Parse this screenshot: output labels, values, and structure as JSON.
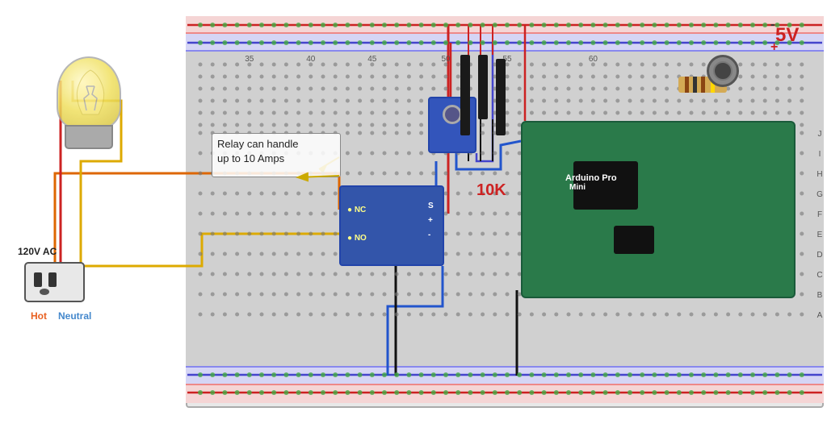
{
  "labels": {
    "voltage": "5V",
    "voltage_minus": "-",
    "voltage_plus": "+",
    "ac_voltage": "120V AC",
    "hot": "Hot",
    "neutral": "Neutral",
    "potentiometer_value": "10K",
    "annotation_line1": "Relay can handle",
    "annotation_line2": "up to 10 Amps",
    "relay_nc": "● NC",
    "relay_no": "● NO",
    "relay_s": "S",
    "relay_plus": "+",
    "relay_minus": "-",
    "arduino_label": "Arduino Pro",
    "arduino_sub": "Mini"
  },
  "colors": {
    "red_wire": "#cc2222",
    "black_wire": "#111111",
    "blue_wire": "#2255cc",
    "yellow_wire": "#ddaa00",
    "orange_wire": "#dd6600",
    "annotation_arrow": "#ccaa00",
    "breadboard_bg": "#d0d0d0",
    "rail_red": "#f5d5d5",
    "rail_blue": "#d5d5f5",
    "arduino_green": "#2a7a4a",
    "relay_blue": "#3355aa",
    "pot_blue": "#3355bb"
  }
}
